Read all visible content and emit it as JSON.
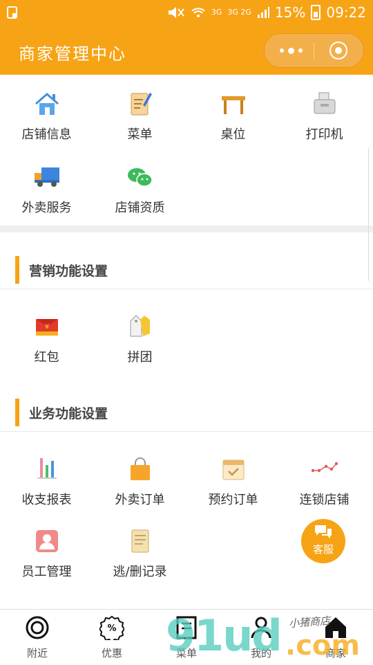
{
  "status_bar": {
    "net1": "3G",
    "net2": "3G 2G",
    "battery": "15%",
    "time": "09:22"
  },
  "header": {
    "title": "商家管理中心"
  },
  "store_grid": [
    {
      "label": "店铺信息",
      "icon": "house-icon"
    },
    {
      "label": "菜单",
      "icon": "menu-note-icon"
    },
    {
      "label": "桌位",
      "icon": "table-icon"
    },
    {
      "label": "打印机",
      "icon": "printer-icon"
    },
    {
      "label": "外卖服务",
      "icon": "delivery-truck-icon"
    },
    {
      "label": "店铺资质",
      "icon": "wechat-icon"
    }
  ],
  "marketing": {
    "title": "营销功能设置",
    "items": [
      {
        "label": "红包",
        "icon": "red-packet-icon"
      },
      {
        "label": "拼团",
        "icon": "group-tag-icon"
      }
    ]
  },
  "business": {
    "title": "业务功能设置",
    "items": [
      {
        "label": "收支报表",
        "icon": "bar-chart-icon"
      },
      {
        "label": "外卖订单",
        "icon": "shopping-bag-icon"
      },
      {
        "label": "预约订单",
        "icon": "calendar-check-icon"
      },
      {
        "label": "连锁店铺",
        "icon": "chain-line-icon"
      },
      {
        "label": "员工管理",
        "icon": "employee-icon"
      },
      {
        "label": "逃/删记录",
        "icon": "scroll-icon"
      }
    ]
  },
  "fab": {
    "label": "客服"
  },
  "tabs": [
    {
      "label": "附近",
      "icon": "target-icon"
    },
    {
      "label": "优惠",
      "icon": "discount-icon"
    },
    {
      "label": "菜单",
      "icon": "menu-icon"
    },
    {
      "label": "我的",
      "icon": "user-icon"
    },
    {
      "label": "商家",
      "icon": "store-home-icon"
    }
  ],
  "watermark": {
    "big": "91ud",
    "com": ".com",
    "small": "小猪商店"
  }
}
